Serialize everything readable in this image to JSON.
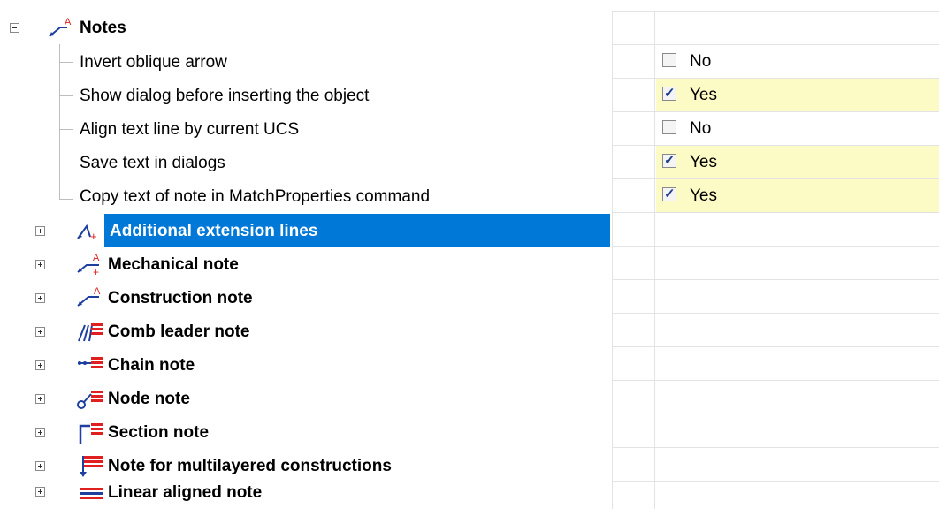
{
  "tree": {
    "root": {
      "label": "Notes"
    },
    "children": [
      {
        "label": "Invert oblique arrow",
        "value": "No",
        "checked": false
      },
      {
        "label": "Show dialog before inserting the object",
        "value": "Yes",
        "checked": true
      },
      {
        "label": "Align text line by current UCS",
        "value": "No",
        "checked": false
      },
      {
        "label": "Save text in dialogs",
        "value": "Yes",
        "checked": true
      },
      {
        "label": "Copy text of note in MatchProperties command",
        "value": "Yes",
        "checked": true
      }
    ],
    "groups": [
      {
        "label": "Additional extension lines",
        "icon": "extension-lines-icon",
        "selected": true
      },
      {
        "label": "Mechanical note",
        "icon": "mechanical-note-icon"
      },
      {
        "label": "Construction note",
        "icon": "construction-note-icon"
      },
      {
        "label": "Comb leader note",
        "icon": "comb-leader-note-icon"
      },
      {
        "label": "Chain note",
        "icon": "chain-note-icon"
      },
      {
        "label": "Node note",
        "icon": "node-note-icon"
      },
      {
        "label": "Section note",
        "icon": "section-note-icon"
      },
      {
        "label": "Note for multilayered constructions",
        "icon": "multilayer-note-icon"
      },
      {
        "label": "Linear aligned note",
        "icon": "linear-aligned-note-icon"
      }
    ]
  },
  "colors": {
    "selection": "#0078d7",
    "value_highlight": "#fdfbc5",
    "icon_red": "#e02020",
    "icon_blue": "#1f3f9f"
  }
}
